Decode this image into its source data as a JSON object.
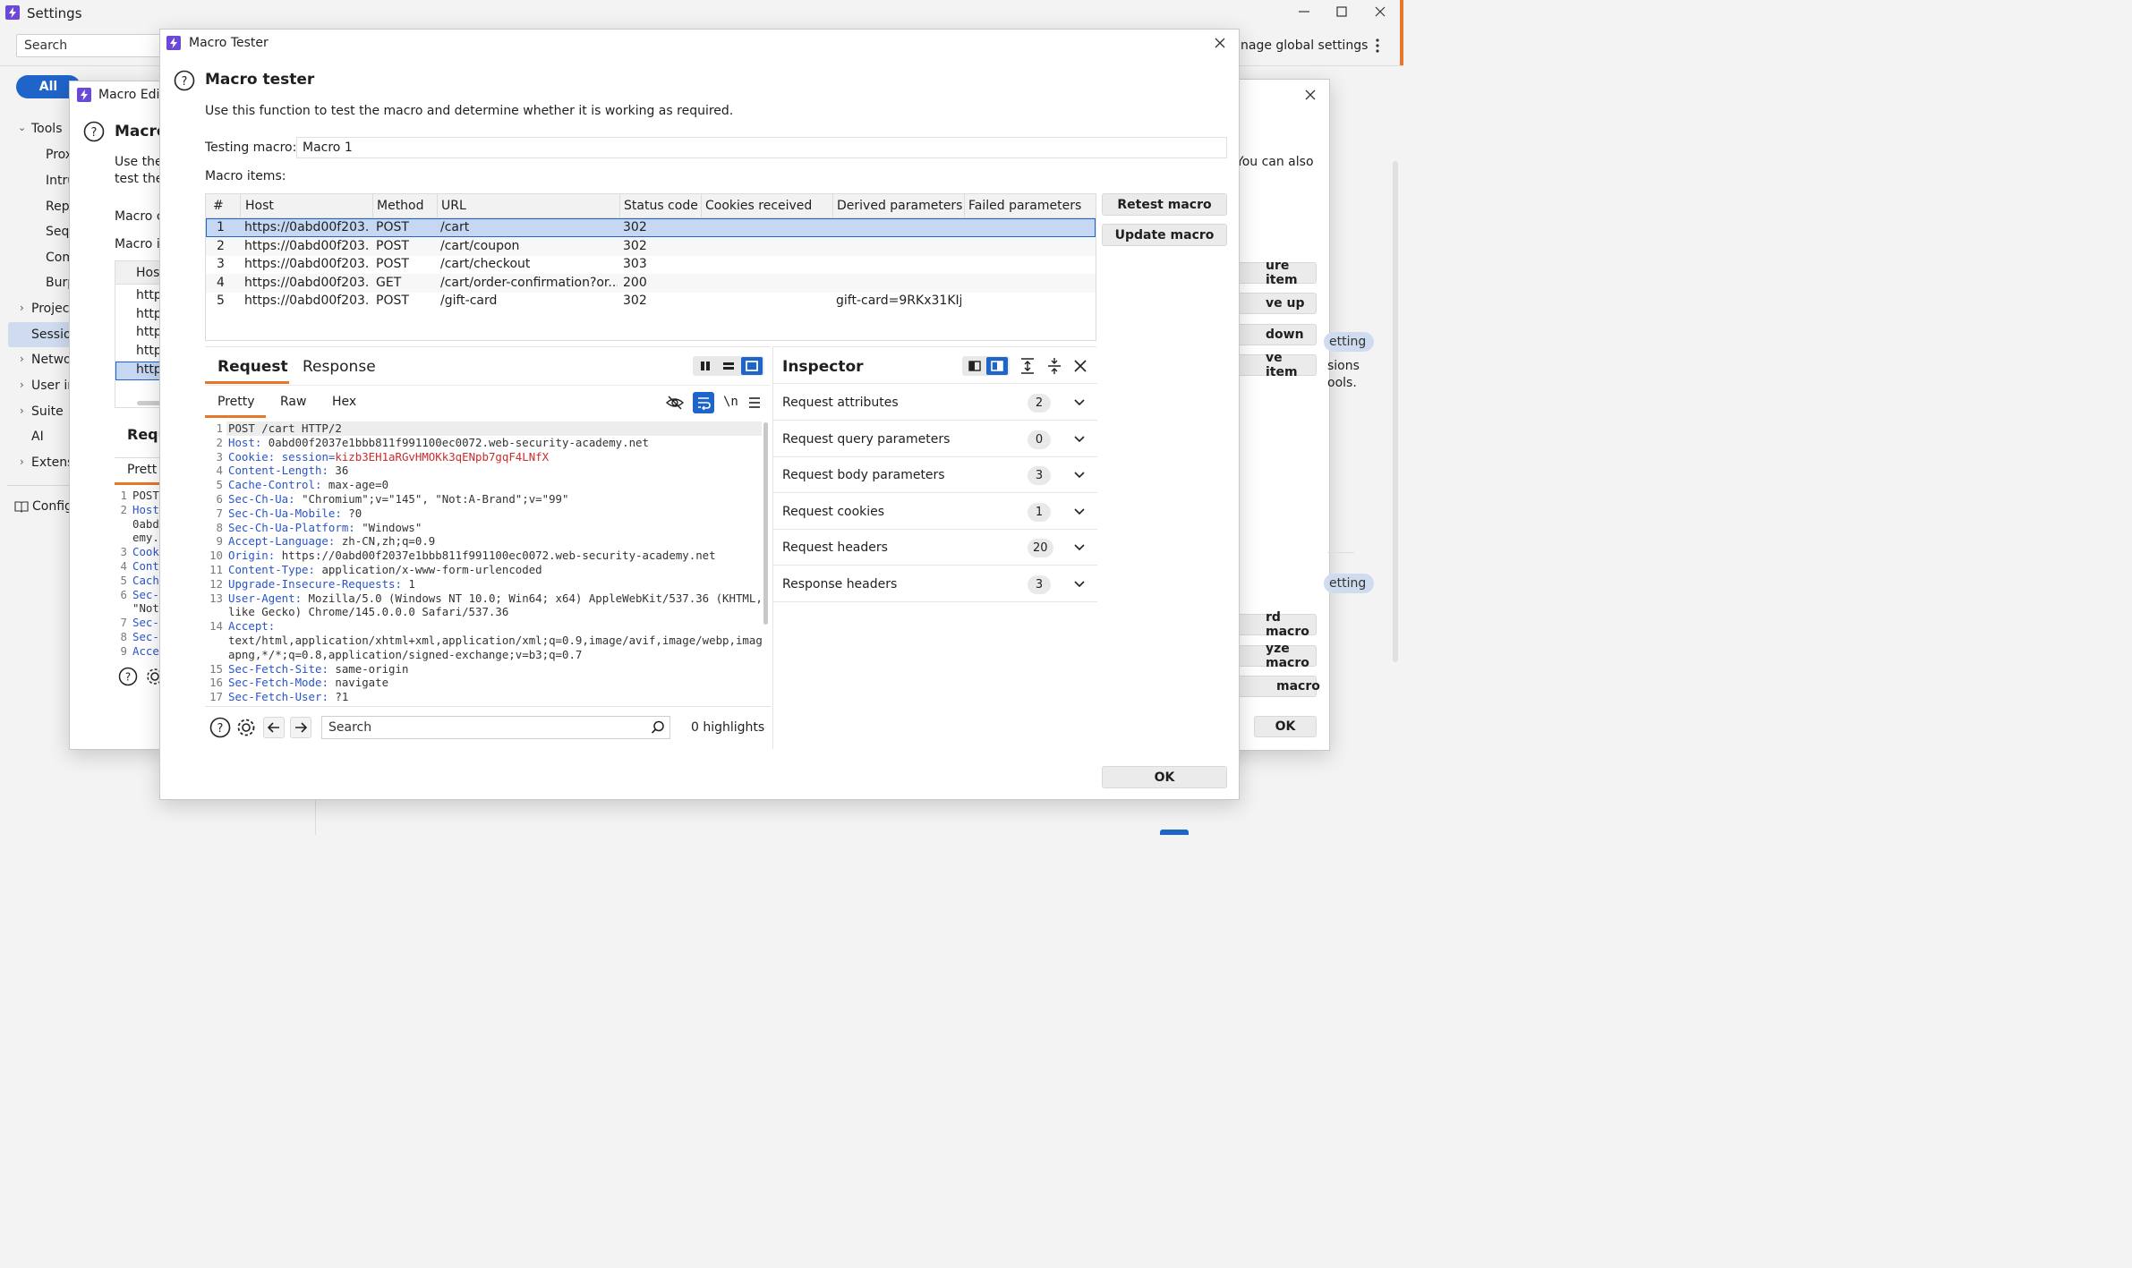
{
  "settings_window": {
    "title": "Settings",
    "search_placeholder": "Search",
    "manage_global": "nage global settings",
    "all_tab": "All",
    "nav": [
      {
        "label": "Tools",
        "expander": "⌄"
      },
      {
        "label": "Prox"
      },
      {
        "label": "Intru"
      },
      {
        "label": "Rep"
      },
      {
        "label": "Seq"
      },
      {
        "label": "Com"
      },
      {
        "label": "Burp"
      },
      {
        "label": "Projec",
        "expander": "›"
      },
      {
        "label": "Sessio"
      },
      {
        "label": "Netwo",
        "expander": "›"
      },
      {
        "label": "User ir",
        "expander": "›"
      },
      {
        "label": "Suite",
        "expander": "›"
      },
      {
        "label": "AI"
      },
      {
        "label": "Extens",
        "expander": "›"
      },
      {
        "label": "Config"
      }
    ]
  },
  "macro_editor_back": {
    "title": "Macro Edit",
    "heading": "Macro",
    "desc1": "Use the",
    "desc2": "test the",
    "label_macro": "Macro c",
    "label_items": "Macro i",
    "col_host": "Host",
    "rows": [
      "http",
      "http",
      "http",
      "http",
      "http"
    ],
    "request_heading": "Requ",
    "pretty_tab": "Prett",
    "code_lines": [
      {
        "n": "1",
        "t": "POST"
      },
      {
        "n": "2",
        "t": "Host"
      },
      {
        "n": "",
        "t": "0abd"
      },
      {
        "n": "",
        "t": "emy."
      },
      {
        "n": "3",
        "t": "Cook"
      },
      {
        "n": "4",
        "t": "Cont"
      },
      {
        "n": "5",
        "t": "Cach"
      },
      {
        "n": "6",
        "t": "Sec-"
      },
      {
        "n": "",
        "t": "\"Not"
      },
      {
        "n": "7",
        "t": "Sec-"
      },
      {
        "n": "8",
        "t": "Sec-"
      },
      {
        "n": "9",
        "t": "Acce"
      }
    ]
  },
  "right_window_back": {
    "desc": "You can also",
    "buttons": [
      "ure item",
      "ve up",
      " down",
      "ve item",
      "rd macro",
      "yze macro",
      "macro"
    ],
    "pill1": "etting",
    "pill2": "etting",
    "sessions_text": "sions",
    "tools_text": "ools.",
    "ok": "OK"
  },
  "tester": {
    "window_title": "Macro Tester",
    "heading": "Macro tester",
    "description": "Use this function to test the macro and determine whether it is working as required.",
    "testing_label": "Testing macro:",
    "testing_value": "Macro 1",
    "items_label": "Macro items:",
    "columns": [
      "#",
      "Host",
      "Method",
      "URL",
      "Status code",
      "Cookies received",
      "Derived parameters",
      "Failed parameters"
    ],
    "rows": [
      {
        "num": "1",
        "host": "https://0abd00f203...",
        "method": "POST",
        "url": "/cart",
        "status": "302",
        "cookies": "",
        "derived": "",
        "failed": ""
      },
      {
        "num": "2",
        "host": "https://0abd00f203...",
        "method": "POST",
        "url": "/cart/coupon",
        "status": "302",
        "cookies": "",
        "derived": "",
        "failed": ""
      },
      {
        "num": "3",
        "host": "https://0abd00f203...",
        "method": "POST",
        "url": "/cart/checkout",
        "status": "303",
        "cookies": "",
        "derived": "",
        "failed": ""
      },
      {
        "num": "4",
        "host": "https://0abd00f203...",
        "method": "GET",
        "url": "/cart/order-confirmation?or...",
        "status": "200",
        "cookies": "",
        "derived": "",
        "failed": ""
      },
      {
        "num": "5",
        "host": "https://0abd00f203...",
        "method": "POST",
        "url": "/gift-card",
        "status": "302",
        "cookies": "",
        "derived": "gift-card=9RKx31KIjB",
        "failed": ""
      }
    ],
    "retest_button": "Retest macro",
    "update_button": "Update macro",
    "ok_button": "OK",
    "request_tab": "Request",
    "response_tab": "Response",
    "view_tabs": [
      "Pretty",
      "Raw",
      "Hex"
    ],
    "newline_toggle": "\\n",
    "code": [
      {
        "n": "1",
        "name": "",
        "value": "POST /cart HTTP/2"
      },
      {
        "n": "2",
        "name": "Host",
        "value": "0abd00f2037e1bbb811f991100ec0072.web-security-academy.net"
      },
      {
        "n": "3",
        "name": "Cookie",
        "cookie_name": "session",
        "value": "kizb3EH1aRGvHMOKk3qENpb7gqF4LNfX"
      },
      {
        "n": "4",
        "name": "Content-Length",
        "value": "36"
      },
      {
        "n": "5",
        "name": "Cache-Control",
        "value": "max-age=0"
      },
      {
        "n": "6",
        "name": "Sec-Ch-Ua",
        "value": "\"Chromium\";v=\"145\", \"Not:A-Brand\";v=\"99\""
      },
      {
        "n": "7",
        "name": "Sec-Ch-Ua-Mobile",
        "value": "?0"
      },
      {
        "n": "8",
        "name": "Sec-Ch-Ua-Platform",
        "value": "\"Windows\""
      },
      {
        "n": "9",
        "name": "Accept-Language",
        "value": "zh-CN,zh;q=0.9"
      },
      {
        "n": "10",
        "name": "Origin",
        "value": "https://0abd00f2037e1bbb811f991100ec0072.web-security-academy.net"
      },
      {
        "n": "11",
        "name": "Content-Type",
        "value": "application/x-www-form-urlencoded"
      },
      {
        "n": "12",
        "name": "Upgrade-Insecure-Requests",
        "value": "1"
      },
      {
        "n": "13",
        "name": "User-Agent",
        "value": "Mozilla/5.0 (Windows NT 10.0; Win64; x64) AppleWebKit/537.36 (KHTML,"
      },
      {
        "n": "",
        "name": "",
        "value": "like Gecko) Chrome/145.0.0.0 Safari/537.36"
      },
      {
        "n": "14",
        "name": "Accept",
        "value": ""
      },
      {
        "n": "",
        "name": "",
        "value": "text/html,application/xhtml+xml,application/xml;q=0.9,image/avif,image/webp,image/"
      },
      {
        "n": "",
        "name": "",
        "value": "apng,*/*;q=0.8,application/signed-exchange;v=b3;q=0.7"
      },
      {
        "n": "15",
        "name": "Sec-Fetch-Site",
        "value": "same-origin"
      },
      {
        "n": "16",
        "name": "Sec-Fetch-Mode",
        "value": "navigate"
      },
      {
        "n": "17",
        "name": "Sec-Fetch-User",
        "value": "?1"
      }
    ],
    "search_placeholder": "Search",
    "highlights": "0 highlights",
    "inspector": {
      "title": "Inspector",
      "rows": [
        {
          "label": "Request attributes",
          "count": "2"
        },
        {
          "label": "Request query parameters",
          "count": "0"
        },
        {
          "label": "Request body parameters",
          "count": "3"
        },
        {
          "label": "Request cookies",
          "count": "1"
        },
        {
          "label": "Request headers",
          "count": "20"
        },
        {
          "label": "Response headers",
          "count": "3"
        }
      ]
    }
  },
  "colors": {
    "accent": "#1f64c9",
    "selection": "#c5d7f2",
    "brand": "#6b49d8",
    "header_name": "#2b55c7",
    "cookie_value": "#c92d2d"
  }
}
